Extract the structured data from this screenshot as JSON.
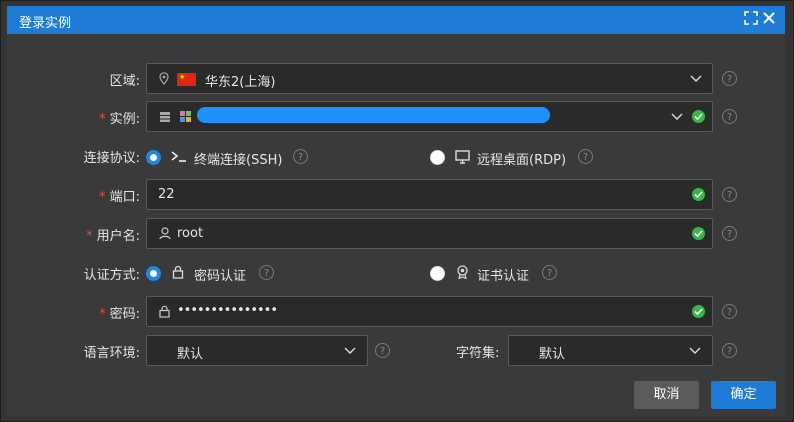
{
  "window": {
    "title": "登录实例"
  },
  "form": {
    "region": {
      "label": "区域:",
      "value": "华东2(上海)"
    },
    "instance": {
      "label": "实例:",
      "value": ""
    },
    "protocol": {
      "label": "连接协议:",
      "options": [
        "终端连接(SSH)",
        "远程桌面(RDP)"
      ],
      "selected": 0
    },
    "port": {
      "label": "端口:",
      "value": "22"
    },
    "username": {
      "label": "用户名:",
      "value": "root"
    },
    "auth": {
      "label": "认证方式:",
      "options": [
        "密码认证",
        "证书认证"
      ],
      "selected": 0
    },
    "password": {
      "label": "密码:",
      "value": "•••••••••••••••"
    },
    "language": {
      "label": "语言环境:",
      "value": "默认"
    },
    "charset": {
      "label": "字符集:",
      "value": "默认"
    }
  },
  "buttons": {
    "cancel": "取消",
    "confirm": "确定"
  },
  "required_mark": "*",
  "colors": {
    "accent": "#1e7bd6",
    "success": "#3bb54a",
    "required": "#e84a4a"
  }
}
